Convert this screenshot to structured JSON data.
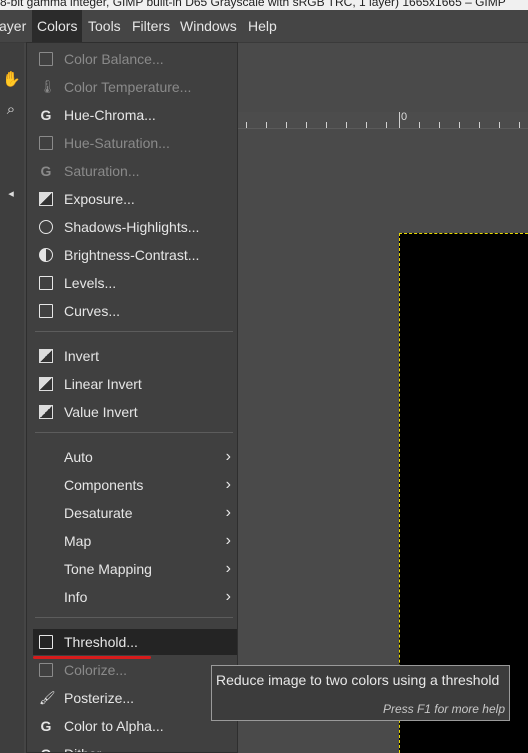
{
  "window": {
    "title": "8-bit gamma integer, GIMP built-in D65 Grayscale with sRGB TRC, 1 layer) 1665x1665 – GIMP"
  },
  "menubar": {
    "items": [
      {
        "label": "ayer"
      },
      {
        "label": "Colors",
        "active": true
      },
      {
        "label": "Tools"
      },
      {
        "label": "Filters"
      },
      {
        "label": "Windows"
      },
      {
        "label": "Help"
      }
    ]
  },
  "ruler": {
    "origin_label": "0"
  },
  "colors_menu": {
    "items": [
      {
        "label": "Color Balance...",
        "icon": "color-balance-icon",
        "disabled": true
      },
      {
        "label": "Color Temperature...",
        "icon": "thermometer-icon",
        "disabled": true
      },
      {
        "label": "Hue-Chroma...",
        "icon": "gegl-icon",
        "disabled": false
      },
      {
        "label": "Hue-Saturation...",
        "icon": "hue-saturation-icon",
        "disabled": true
      },
      {
        "label": "Saturation...",
        "icon": "gegl-icon",
        "disabled": true
      },
      {
        "label": "Exposure...",
        "icon": "exposure-icon",
        "disabled": false
      },
      {
        "label": "Shadows-Highlights...",
        "icon": "shadows-highlights-icon",
        "disabled": false
      },
      {
        "label": "Brightness-Contrast...",
        "icon": "brightness-contrast-icon",
        "disabled": false
      },
      {
        "label": "Levels...",
        "icon": "levels-icon",
        "disabled": false
      },
      {
        "label": "Curves...",
        "icon": "curves-icon",
        "disabled": false
      },
      {
        "label": "Invert",
        "icon": "invert-icon",
        "disabled": false
      },
      {
        "label": "Linear Invert",
        "icon": "invert-icon",
        "disabled": false
      },
      {
        "label": "Value Invert",
        "icon": "invert-icon",
        "disabled": false
      },
      {
        "label": "Auto",
        "submenu": true
      },
      {
        "label": "Components",
        "submenu": true
      },
      {
        "label": "Desaturate",
        "submenu": true
      },
      {
        "label": "Map",
        "submenu": true
      },
      {
        "label": "Tone Mapping",
        "submenu": true
      },
      {
        "label": "Info",
        "submenu": true
      },
      {
        "label": "Threshold...",
        "icon": "threshold-icon",
        "disabled": false,
        "highlighted": true
      },
      {
        "label": "Colorize...",
        "icon": "colorize-icon",
        "disabled": true
      },
      {
        "label": "Posterize...",
        "icon": "posterize-icon",
        "disabled": false
      },
      {
        "label": "Color to Alpha...",
        "icon": "gegl-icon",
        "disabled": false
      },
      {
        "label": "Dither...",
        "icon": "gegl-icon",
        "disabled": false
      }
    ]
  },
  "tooltip": {
    "text": "Reduce image to two colors using a threshold",
    "hint": "Press F1 for more help"
  },
  "colors": {
    "menu_bg": "#404040",
    "highlight_bg": "#242424",
    "annotation_red": "#d61c1c",
    "selection_outline": "#e8d800"
  }
}
